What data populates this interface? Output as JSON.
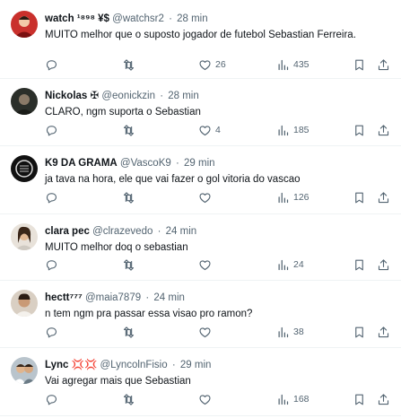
{
  "replies": [
    {
      "name": "watch",
      "name_extra": "¹⁸⁹⁸ ¥$",
      "handle": "@watchsr2",
      "time": "28 min",
      "text": "MUITO melhor que o suposto jogador de futebol Sebastian Ferreira.",
      "likes": "26",
      "views": "435"
    },
    {
      "name": "Nickolas",
      "name_extra": "✠",
      "handle": "@eonickzin",
      "time": "28 min",
      "text": "CLARO, ngm suporta o Sebastian",
      "likes": "4",
      "views": "185"
    },
    {
      "name": "K9 DA GRAMA",
      "name_extra": "",
      "handle": "@VascoK9",
      "time": "29 min",
      "text": "ja tava na hora,  ele que vai fazer o gol vitoria do vascao",
      "likes": "",
      "views": "126"
    },
    {
      "name": "clara pec",
      "name_extra": "",
      "handle": "@clrazevedo",
      "time": "24 min",
      "text": "MUITO melhor doq o sebastian",
      "likes": "",
      "views": "24"
    },
    {
      "name": "hectt",
      "name_extra": "⁷⁷⁷",
      "handle": "@maia7879",
      "time": "24 min",
      "text": "n tem ngm pra passar essa visao pro ramon?",
      "likes": "",
      "views": "38"
    },
    {
      "name": "Lync",
      "name_extra": "💢💢",
      "handle": "@LyncolnFisio",
      "time": "29 min",
      "text": "Vai agregar mais que Sebastian",
      "likes": "",
      "views": "168"
    }
  ],
  "separator": "·",
  "icons": [
    "reply-icon",
    "retweet-icon",
    "like-icon",
    "views-icon",
    "bookmark-icon",
    "share-icon"
  ],
  "colors": {
    "text": "#0f1419",
    "secondary": "#536471",
    "divider": "#eff3f4"
  }
}
